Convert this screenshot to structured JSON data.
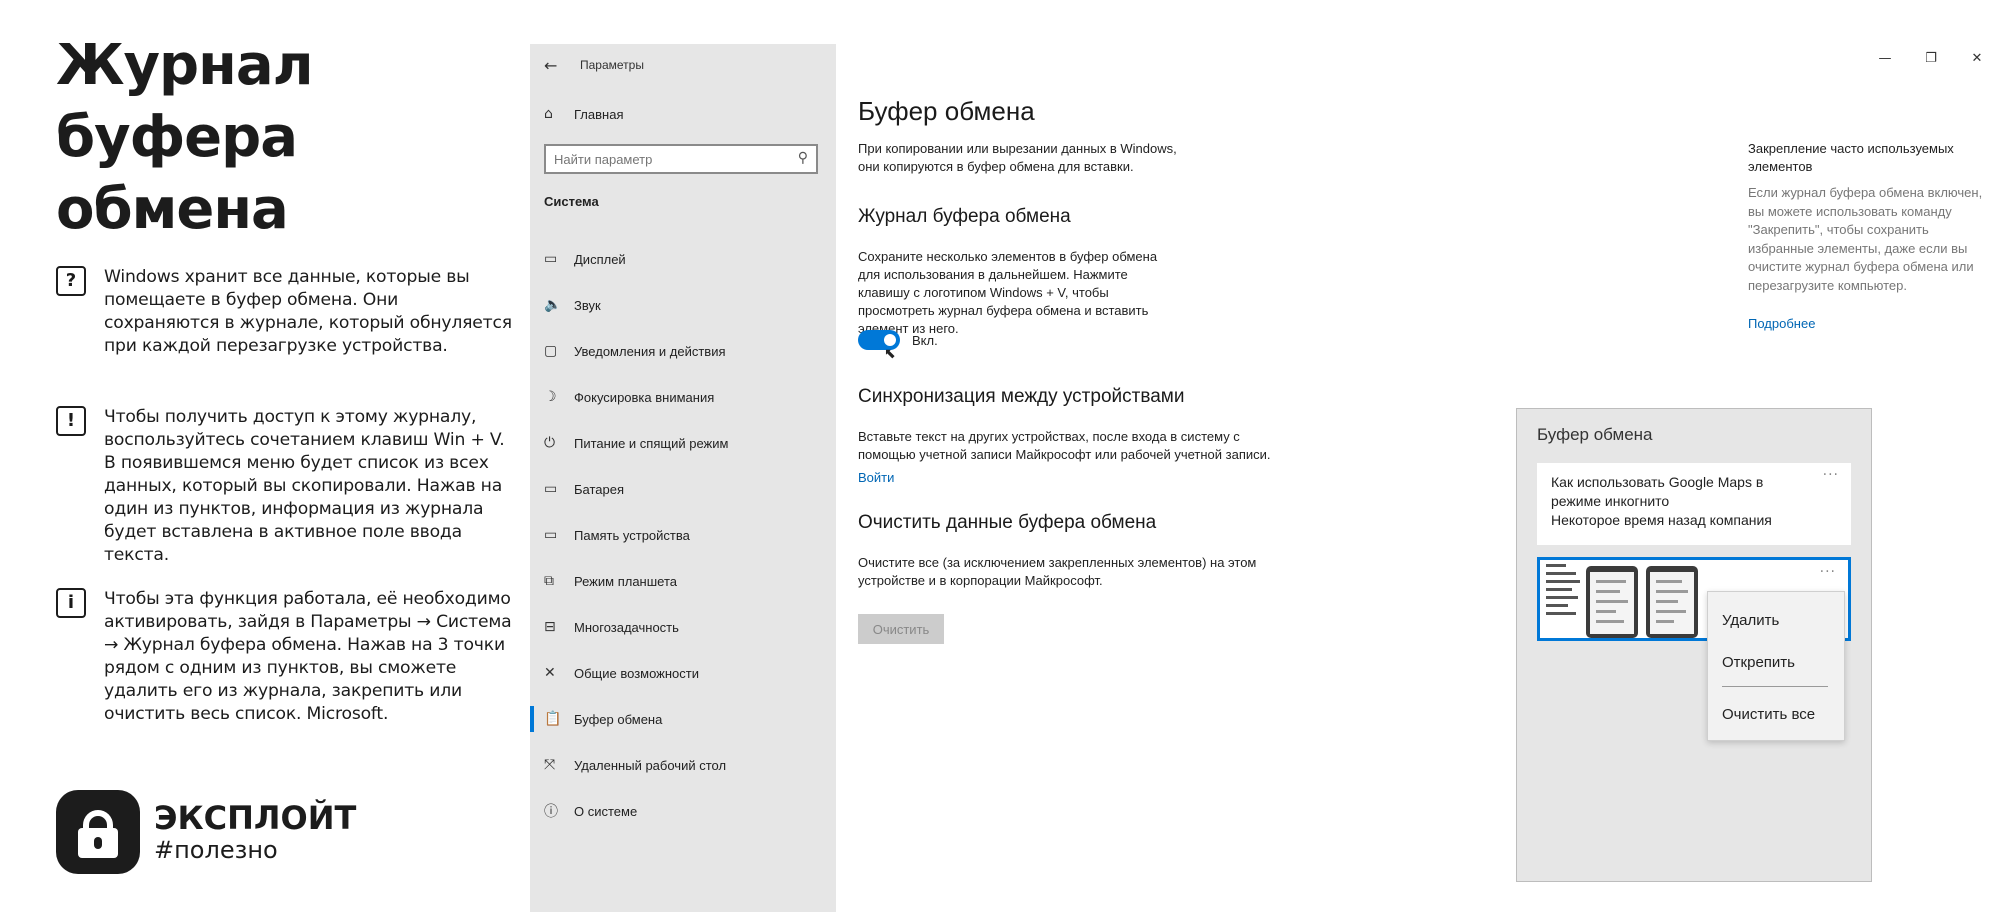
{
  "article": {
    "title": "Журнал\nбуфера\nобмена",
    "tips": [
      {
        "icon": "?",
        "icon_name": "question-icon",
        "text": "Windows хранит все данные, которые вы помещаете в буфер обмена. Они сохраняются в журнале, который обнуляется при каждой перезагрузке устройства."
      },
      {
        "icon": "!",
        "icon_name": "exclamation-icon",
        "text": "Чтобы получить доступ к этому журналу, воспользуйтесь сочетанием клавиш Win + V. В появившемся меню будет список из всех данных, который вы скопировали. Нажав на один из пунктов, информация из журнала будет вставлена в активное поле ввода текста."
      },
      {
        "icon": "i",
        "icon_name": "info-icon",
        "text": "Чтобы эта функция работала, её необходимо активировать, зайдя в Параметры → Система → Журнал буфера обмена. Нажав на 3 точки рядом с одним из пунктов, вы сможете удалить его из журнала, закрепить или очистить весь список. Microsoft."
      }
    ],
    "brand": {
      "name": "ЭКСПЛОЙТ",
      "tag": "#полезно",
      "icon_name": "lock-icon"
    }
  },
  "settings": {
    "app_title": "Параметры",
    "home_label": "Главная",
    "search_placeholder": "Найти параметр",
    "section_label": "Система",
    "nav_items": [
      {
        "icon": "▭",
        "icon_name": "display-icon",
        "label": "Дисплей"
      },
      {
        "icon": "🔈",
        "icon_name": "sound-icon",
        "label": "Звук"
      },
      {
        "icon": "▢",
        "icon_name": "notifications-icon",
        "label": "Уведомления и действия"
      },
      {
        "icon": "☽",
        "icon_name": "focus-assist-icon",
        "label": "Фокусировка внимания"
      },
      {
        "icon": "⏻",
        "icon_name": "power-icon",
        "label": "Питание и спящий режим"
      },
      {
        "icon": "▭",
        "icon_name": "battery-icon",
        "label": "Батарея"
      },
      {
        "icon": "▭",
        "icon_name": "storage-icon",
        "label": "Память устройства"
      },
      {
        "icon": "⧉",
        "icon_name": "tablet-mode-icon",
        "label": "Режим планшета"
      },
      {
        "icon": "⊟",
        "icon_name": "multitasking-icon",
        "label": "Многозадачность"
      },
      {
        "icon": "✕",
        "icon_name": "shared-experiences-icon",
        "label": "Общие возможности"
      },
      {
        "icon": "📋",
        "icon_name": "clipboard-icon",
        "label": "Буфер обмена",
        "active": true
      },
      {
        "icon": "⤧",
        "icon_name": "remote-desktop-icon",
        "label": "Удаленный рабочий стол"
      },
      {
        "icon": "ⓘ",
        "icon_name": "about-icon",
        "label": "О системе"
      }
    ],
    "page_title": "Буфер обмена",
    "intro": "При копировании или вырезании данных в Windows, они копируются в буфер обмена для вставки.",
    "history": {
      "heading": "Журнал буфера обмена",
      "text": "Сохраните несколько элементов в буфер обмена для использования в дальнейшем. Нажмите клавишу с логотипом Windows + V, чтобы просмотреть журнал буфера обмена и вставить элемент из него.",
      "toggle_label": "Вкл."
    },
    "sync": {
      "heading": "Синхронизация между устройствами",
      "text": "Вставьте текст на других устройствах, после входа в систему с помощью учетной записи Майкрософт или рабочей учетной записи.",
      "link": "Войти"
    },
    "clear": {
      "heading": "Очистить данные буфера обмена",
      "text": "Очистите все (за исключением закрепленных элементов) на этом устройстве и в корпорации Майкрософт.",
      "button": "Очистить"
    },
    "side": {
      "heading": "Закрепление часто используемых элементов",
      "text": "Если журнал буфера обмена включен, вы можете использовать команду \"Закрепить\", чтобы сохранить избранные элементы, даже если вы очистите журнал буфера обмена или перезагрузите компьютер.",
      "link": "Подробнее"
    }
  },
  "flyout": {
    "title": "Буфер обмена",
    "item_text": "Как использовать Google Maps в режиме инкогнито\nНекоторое время назад компания",
    "more": "···",
    "menu": [
      "Удалить",
      "Открепить",
      "Очистить все"
    ]
  }
}
